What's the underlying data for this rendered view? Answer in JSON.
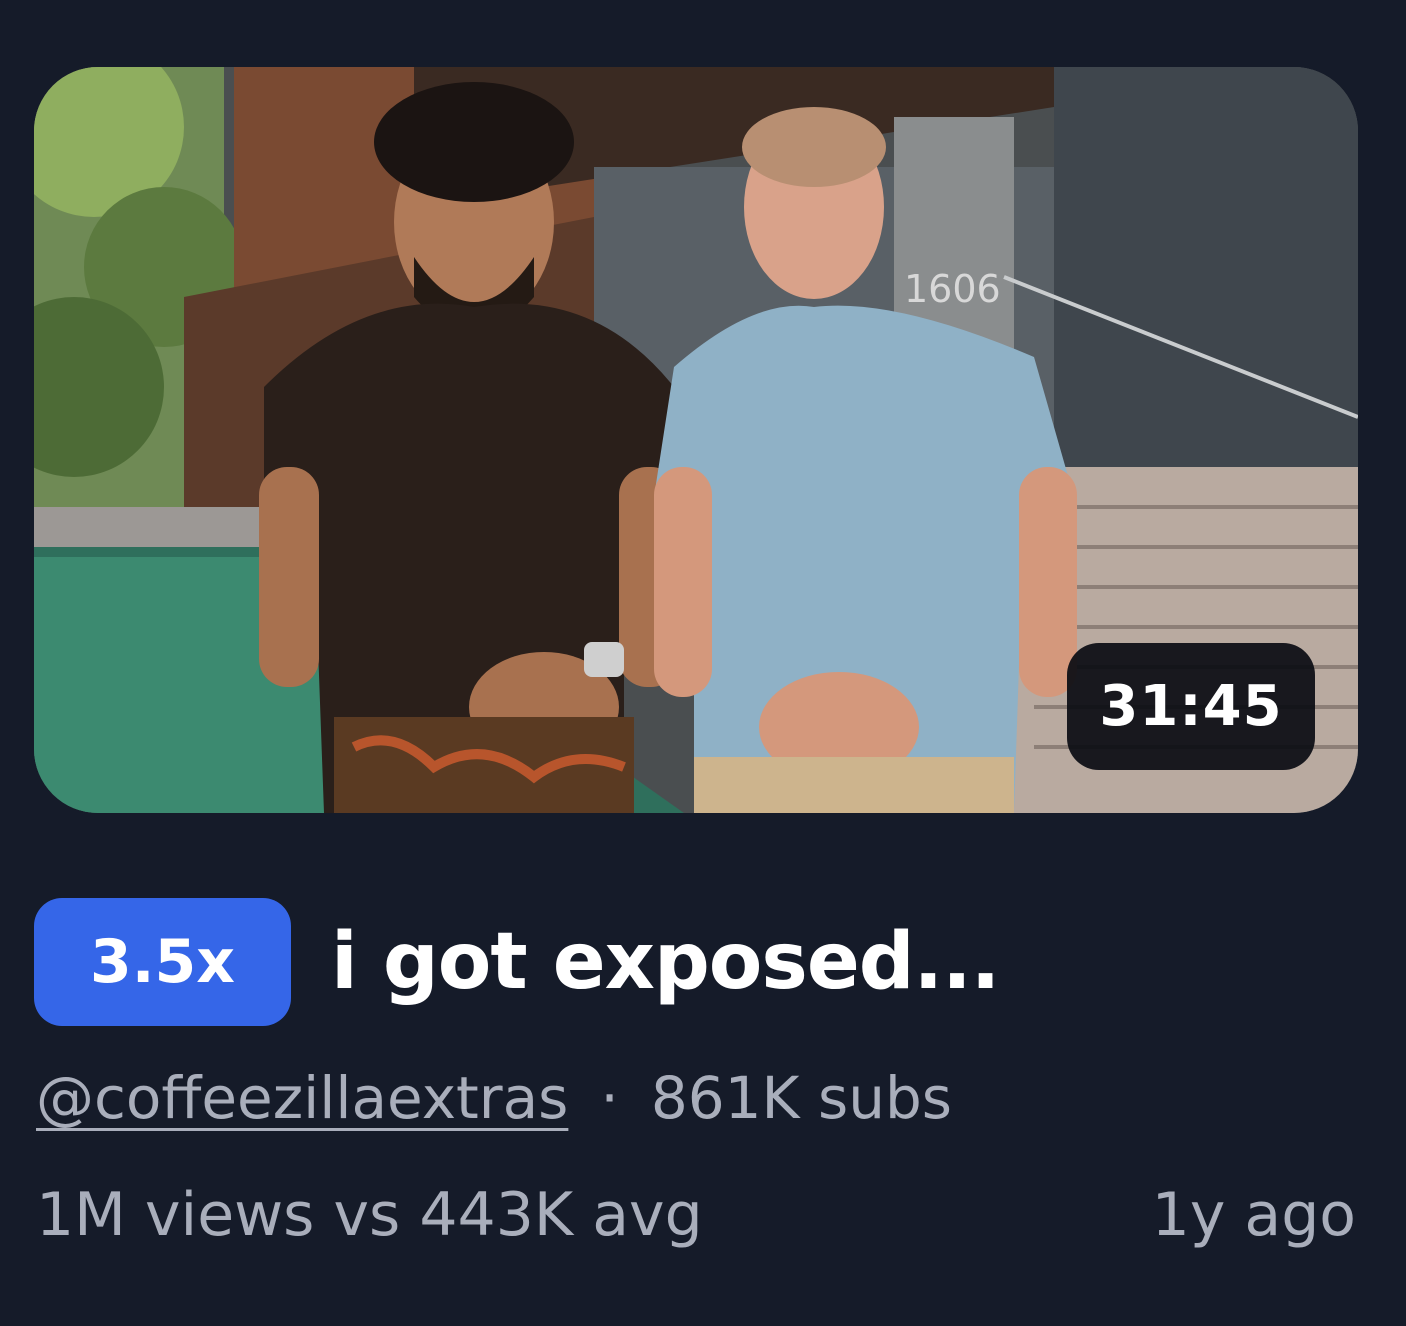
{
  "video": {
    "duration": "31:45",
    "multiplier": "3.5x",
    "title": "i got exposed...",
    "channel_handle": "@coffeezillaextras",
    "separator": "·",
    "subscribers": "861K subs",
    "views_comparison": "1M views vs 443K avg",
    "age": "1y ago",
    "thumbnail_sign": "1606"
  },
  "colors": {
    "background": "#151b29",
    "multiplier_badge": "#3566e8",
    "meta_text": "#a9aebb",
    "duration_badge": "#0a0c12"
  }
}
